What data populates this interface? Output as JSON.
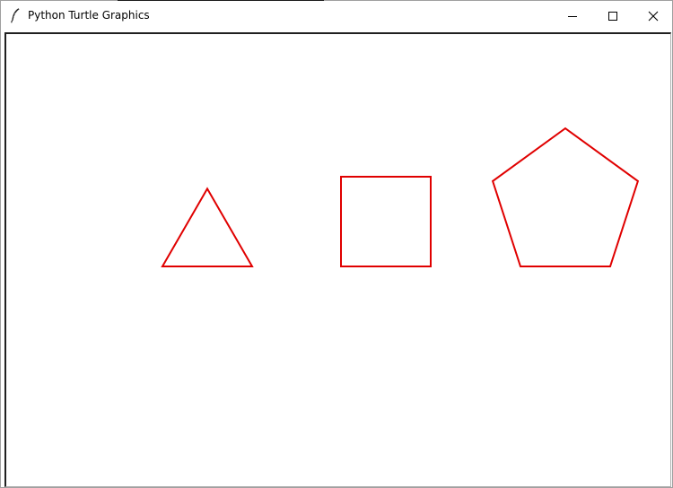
{
  "window": {
    "title": "Python Turtle Graphics",
    "app_icon": "feather-icon",
    "controls": {
      "minimize_icon": "minimize-icon",
      "maximize_icon": "maximize-icon",
      "close_icon": "close-icon"
    }
  },
  "canvas": {
    "background": "#ffffff",
    "pen_color": "#e00000",
    "shapes": [
      {
        "name": "triangle",
        "sides": 3,
        "side_length": 100
      },
      {
        "name": "square",
        "sides": 4,
        "side_length": 100
      },
      {
        "name": "pentagon",
        "sides": 5,
        "side_length": 100
      }
    ]
  }
}
